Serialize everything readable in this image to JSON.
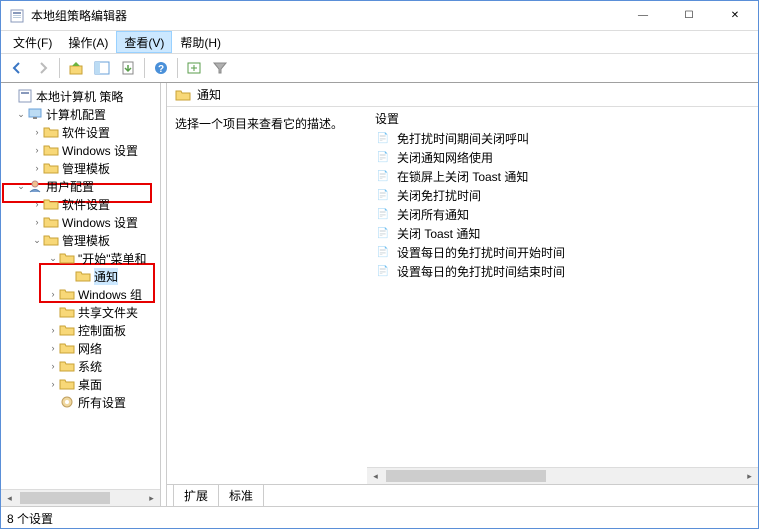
{
  "window": {
    "title": "本地组策略编辑器",
    "min": "—",
    "max": "☐",
    "close": "✕"
  },
  "menu": {
    "file": "文件(F)",
    "action": "操作(A)",
    "view": "查看(V)",
    "help": "帮助(H)"
  },
  "tree": {
    "root": "本地计算机 策略",
    "computer_config": "计算机配置",
    "cc_software": "软件设置",
    "cc_windows": "Windows 设置",
    "cc_templates": "管理模板",
    "user_config": "用户配置",
    "uc_software": "软件设置",
    "uc_windows": "Windows 设置",
    "uc_templates": "管理模板",
    "start_menu": "\"开始\"菜单和",
    "notifications": "通知",
    "windows_components": "Windows 组",
    "shared_folders": "共享文件夹",
    "control_panel": "控制面板",
    "network": "网络",
    "system": "系统",
    "desktop": "桌面",
    "all_settings": "所有设置"
  },
  "content": {
    "header": "通知",
    "description_hint": "选择一个项目来查看它的描述。",
    "settings_col": "设置",
    "items": {
      "0": "免打扰时间期间关闭呼叫",
      "1": "关闭通知网络使用",
      "2": "在锁屏上关闭 Toast 通知",
      "3": "关闭免打扰时间",
      "4": "关闭所有通知",
      "5": "关闭 Toast 通知",
      "6": "设置每日的免打扰时间开始时间",
      "7": "设置每日的免打扰时间结束时间"
    }
  },
  "tabs": {
    "extended": "扩展",
    "standard": "标准"
  },
  "status": "8 个设置"
}
